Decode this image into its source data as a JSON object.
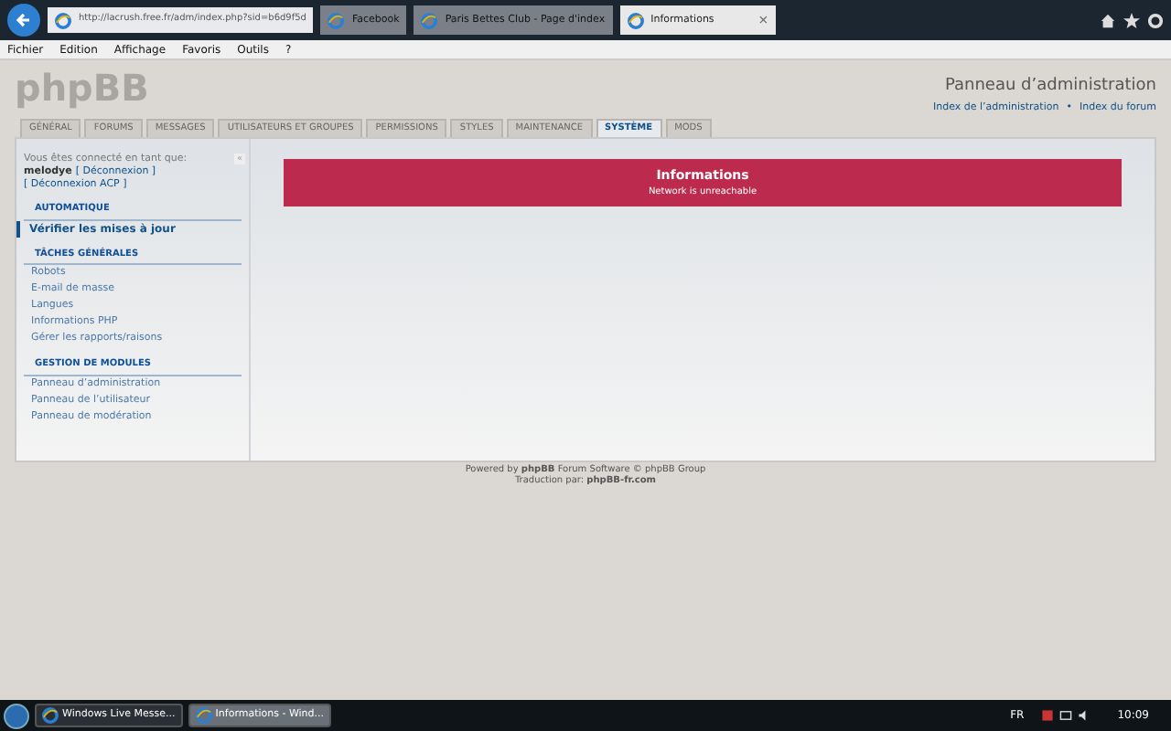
{
  "browser": {
    "address": "http://lacrush.free.fr/adm/index.php?sid=b6d9f5d",
    "tabs": [
      {
        "label": "Facebook",
        "selected": false
      },
      {
        "label": "Paris Bettes Club - Page d'index",
        "selected": false
      },
      {
        "label": "Informations",
        "selected": true
      }
    ],
    "close_tab": "×",
    "menu": [
      "Fichier",
      "Edition",
      "Affichage",
      "Favoris",
      "Outils",
      "?"
    ]
  },
  "header": {
    "logo": "phpBB",
    "title": "Panneau d’administration",
    "links": [
      "Index de l’administration",
      "Index du forum"
    ],
    "separator": "•"
  },
  "tabs": [
    {
      "label": "GÉNÉRAL",
      "selected": false
    },
    {
      "label": "FORUMS",
      "selected": false
    },
    {
      "label": "MESSAGES",
      "selected": false
    },
    {
      "label": "UTILISATEURS ET GROUPES",
      "selected": false
    },
    {
      "label": "PERMISSIONS",
      "selected": false
    },
    {
      "label": "STYLES",
      "selected": false
    },
    {
      "label": "MAINTENANCE",
      "selected": false
    },
    {
      "label": "SYSTÈME",
      "selected": true
    },
    {
      "label": "MODS",
      "selected": false
    }
  ],
  "sidebar": {
    "logged_in": "Vous êtes connecté en tant que:",
    "user": "melodye",
    "logout": "[ Déconnexion ]",
    "logout_acp": "[ Déconnexion ACP ]",
    "collapse": "«",
    "sections": [
      {
        "title": "AUTOMATIQUE",
        "items": [
          {
            "label": "Vérifier les mises à jour",
            "selected": true
          }
        ]
      },
      {
        "title": "TÂCHES GÉNÉRALES",
        "items": [
          {
            "label": "Robots",
            "selected": false
          },
          {
            "label": "E-mail de masse",
            "selected": false
          },
          {
            "label": "Langues",
            "selected": false
          },
          {
            "label": "Informations PHP",
            "selected": false
          },
          {
            "label": "Gérer les rapports/raisons",
            "selected": false
          }
        ]
      },
      {
        "title": "GESTION DE MODULES",
        "items": [
          {
            "label": "Panneau d’administration",
            "selected": false
          },
          {
            "label": "Panneau de l’utilisateur",
            "selected": false
          },
          {
            "label": "Panneau de modération",
            "selected": false
          }
        ]
      }
    ]
  },
  "message": {
    "title": "Informations",
    "text": "Network is unreachable"
  },
  "footer": [
    "Powered by **phpBB** Forum Software © phpBB Group",
    "Traduction par: **phpBB-fr.com**"
  ],
  "taskbar": {
    "items": [
      {
        "label": "Windows Live Messe...",
        "selected": false
      },
      {
        "label": "Informations - Wind...",
        "selected": true
      }
    ],
    "language": "FR",
    "clock": "10:09"
  }
}
